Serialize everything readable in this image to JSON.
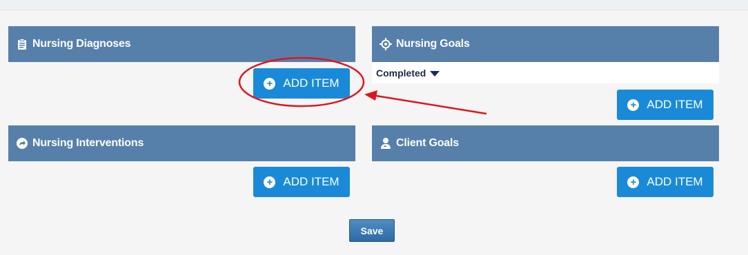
{
  "panels": {
    "nursing_diagnoses": {
      "title": "Nursing Diagnoses",
      "icon": "clipboard-icon",
      "add_label": "ADD ITEM"
    },
    "nursing_goals": {
      "title": "Nursing Goals",
      "icon": "target-icon",
      "add_label": "ADD ITEM",
      "status_value": "Completed"
    },
    "nursing_interventions": {
      "title": "Nursing Interventions",
      "icon": "arrow-circle-icon",
      "add_label": "ADD ITEM"
    },
    "client_goals": {
      "title": "Client Goals",
      "icon": "user-icon",
      "add_label": "ADD ITEM"
    }
  },
  "save_label": "Save",
  "colors": {
    "header": "#5680aa",
    "button": "#1a8ad8",
    "annotation": "#e0141e"
  }
}
